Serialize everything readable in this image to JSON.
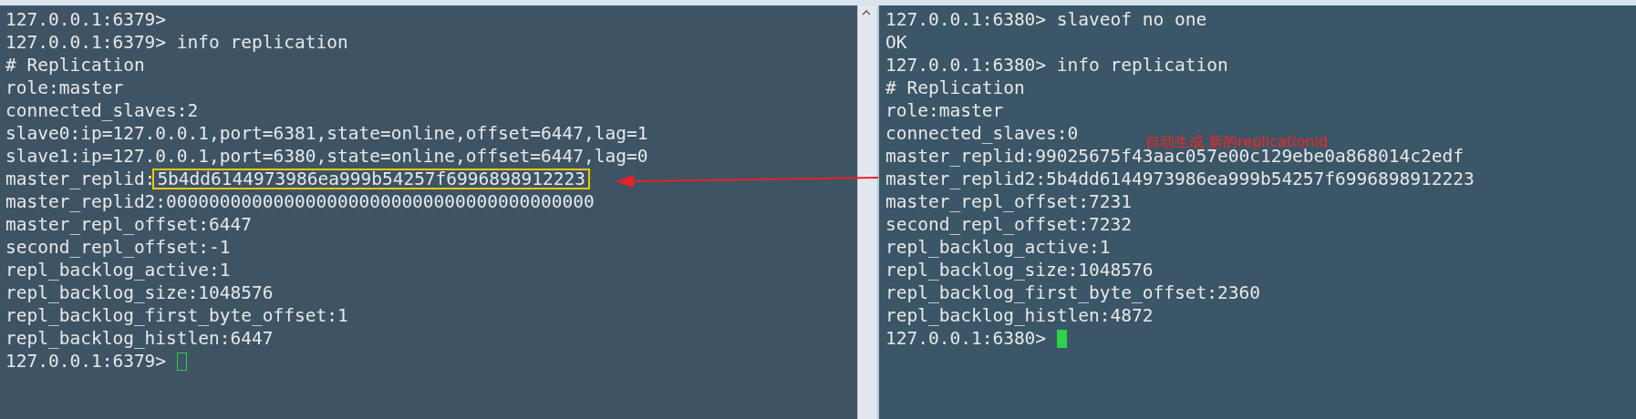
{
  "panes": [
    {
      "has_scrollbar": true,
      "cursor": {
        "focused": false
      },
      "lines": [
        {
          "text": "127.0.0.1:6379>"
        },
        {
          "text": "127.0.0.1:6379> info replication"
        },
        {
          "text": "# Replication"
        },
        {
          "text": "role:master"
        },
        {
          "text": "connected_slaves:2"
        },
        {
          "text": "slave0:ip=127.0.0.1,port=6381,state=online,offset=6447,lag=1"
        },
        {
          "text": "slave1:ip=127.0.0.1,port=6380,state=online,offset=6447,lag=0"
        },
        {
          "text": "master_replid:",
          "highlight": "5b4dd6144973986ea999b54257f6996898912223"
        },
        {
          "text": "master_replid2:0000000000000000000000000000000000000000"
        },
        {
          "text": "master_repl_offset:6447"
        },
        {
          "text": "second_repl_offset:-1"
        },
        {
          "text": "repl_backlog_active:1"
        },
        {
          "text": "repl_backlog_size:1048576"
        },
        {
          "text": "repl_backlog_first_byte_offset:1"
        },
        {
          "text": "repl_backlog_histlen:6447"
        },
        {
          "text": "127.0.0.1:6379>"
        }
      ]
    },
    {
      "has_scrollbar": false,
      "cursor": {
        "focused": true
      },
      "annotation": "自动生成 新的replicationid",
      "lines": [
        {
          "text": "127.0.0.1:6380> slaveof no one"
        },
        {
          "text": "OK"
        },
        {
          "text": "127.0.0.1:6380> info replication"
        },
        {
          "text": "# Replication"
        },
        {
          "text": "role:master"
        },
        {
          "text": "connected_slaves:0"
        },
        {
          "text": "master_replid:99025675f43aac057e00c129ebe0a868014c2edf"
        },
        {
          "text": "master_replid2:5b4dd6144973986ea999b54257f6996898912223"
        },
        {
          "text": "master_repl_offset:7231"
        },
        {
          "text": "second_repl_offset:7232"
        },
        {
          "text": "repl_backlog_active:1"
        },
        {
          "text": "repl_backlog_size:1048576"
        },
        {
          "text": "repl_backlog_first_byte_offset:2360"
        },
        {
          "text": "repl_backlog_histlen:4872"
        },
        {
          "text": "127.0.0.1:6380>"
        }
      ]
    }
  ]
}
